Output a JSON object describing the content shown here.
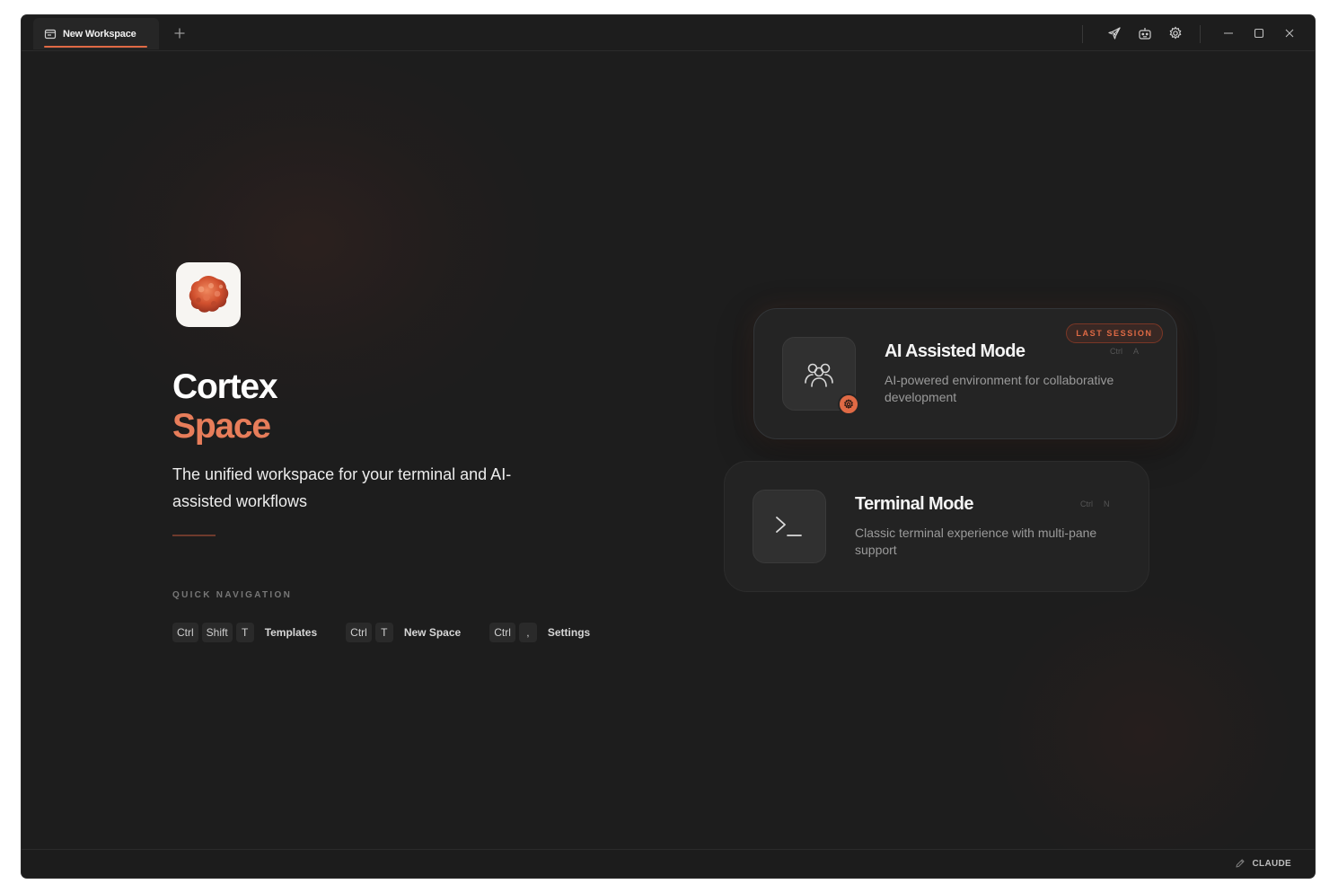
{
  "titlebar": {
    "tab_label": "New Workspace",
    "tab_icon": "window-icon",
    "new_tab_icon": "plus-icon",
    "actions": [
      "rocket-icon",
      "robot-icon",
      "gear-icon"
    ],
    "window_controls": [
      "minimize-icon",
      "maximize-icon",
      "close-icon"
    ]
  },
  "hero": {
    "logo_icon": "cortex-logo-icon",
    "title_line1": "Cortex",
    "title_line2": "Space",
    "tagline": "The unified workspace for your terminal and AI-assisted workflows",
    "quick_nav_label": "QUICK NAVIGATION",
    "shortcuts": [
      {
        "keys": [
          "Ctrl",
          "Shift",
          "T"
        ],
        "label": "Templates"
      },
      {
        "keys": [
          "Ctrl",
          "T"
        ],
        "label": "New Space"
      },
      {
        "keys": [
          "Ctrl",
          ","
        ],
        "label": "Settings"
      }
    ]
  },
  "modes": {
    "ai": {
      "title": "AI Assisted Mode",
      "description": "AI-powered environment for collaborative development",
      "badge": "LAST SESSION",
      "keys": [
        "Ctrl",
        "A"
      ],
      "icon": "users-icon"
    },
    "terminal": {
      "title": "Terminal Mode",
      "description": "Classic terminal experience with multi-pane support",
      "keys": [
        "Ctrl",
        "N"
      ],
      "icon": "terminal-icon"
    }
  },
  "status": {
    "provider_label": "CLAUDE",
    "provider_icon": "pencil-icon"
  },
  "colors": {
    "accent": "#e06a45",
    "background": "#1d1d1d",
    "card": "#252525"
  }
}
